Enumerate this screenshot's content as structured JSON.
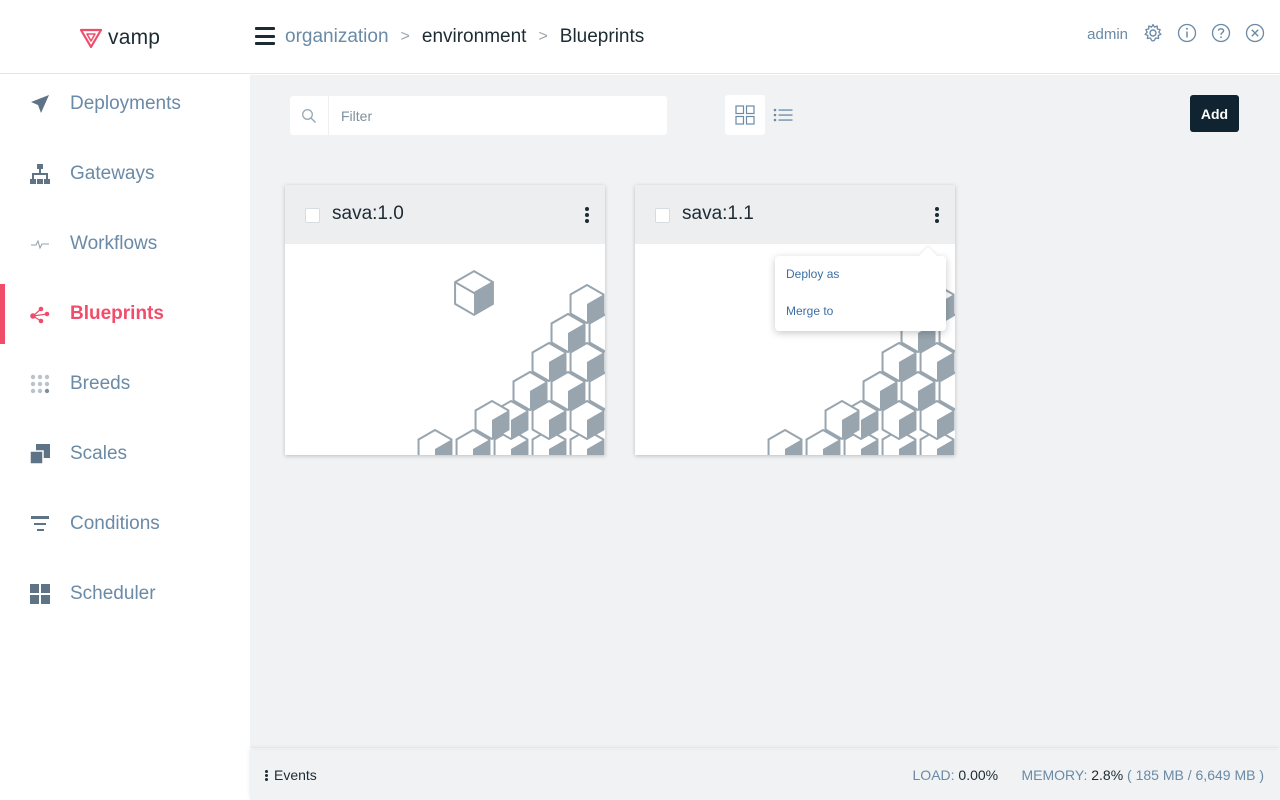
{
  "app": {
    "name": "vamp"
  },
  "breadcrumb": {
    "organization": "organization",
    "environment": "environment",
    "current": "Blueprints",
    "separator": ">"
  },
  "user": {
    "name": "admin"
  },
  "colors": {
    "accent": "#ef4d6a",
    "nav_text": "#6a8aa6",
    "dark": "#0f2330",
    "link": "#3b6ea5"
  },
  "sidebar": {
    "items": [
      {
        "label": "Deployments",
        "icon": "paper-plane-icon"
      },
      {
        "label": "Gateways",
        "icon": "sitemap-icon"
      },
      {
        "label": "Workflows",
        "icon": "pulse-icon"
      },
      {
        "label": "Blueprints",
        "icon": "nodes-icon",
        "active": true
      },
      {
        "label": "Breeds",
        "icon": "dots-grid-icon"
      },
      {
        "label": "Scales",
        "icon": "layers-icon"
      },
      {
        "label": "Conditions",
        "icon": "filter-lines-icon"
      },
      {
        "label": "Scheduler",
        "icon": "grid-squares-icon"
      }
    ]
  },
  "toolbar": {
    "filter_placeholder": "Filter",
    "add_label": "Add"
  },
  "cards": [
    {
      "title": "sava:1.0"
    },
    {
      "title": "sava:1.1"
    }
  ],
  "dropdown": {
    "items": [
      "Deploy as",
      "Merge to"
    ]
  },
  "footer": {
    "events_label": "Events",
    "load_label": "LOAD:",
    "load_value": "0.00%",
    "memory_label": "MEMORY:",
    "memory_value": "2.8%",
    "memory_detail": "( 185 MB / 6,649 MB )"
  }
}
